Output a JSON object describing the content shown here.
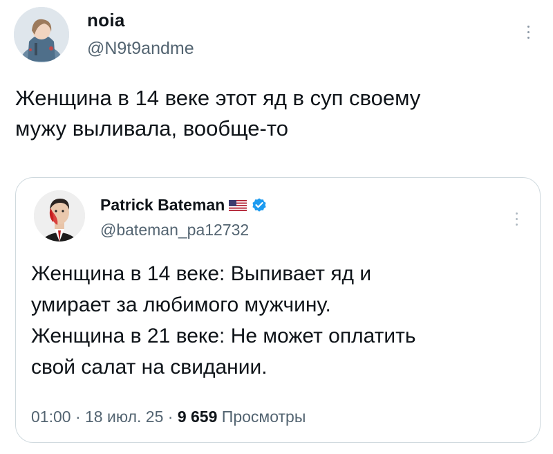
{
  "tweet": {
    "author": {
      "name": "noia",
      "handle": "@N9t9andme"
    },
    "text_lines": [
      "Женщина в 14 веке этот яд в суп своему",
      "мужу выливала, вообще-то"
    ]
  },
  "quoted_tweet": {
    "author": {
      "name": "Patrick Bateman",
      "handle": "@bateman_pa12732",
      "flag_icon": "us-flag-icon",
      "verified_icon": "verified-badge-icon",
      "verified_color": "#1d9bf0"
    },
    "text_lines": [
      "Женщина в 14 веке: Выпивает яд и",
      "умирает за любимого мужчину.",
      "Женщина в 21 веке: Не может оплатить",
      "свой салат на свидании."
    ],
    "meta": {
      "time": "01:00",
      "separator": "·",
      "date": "18 июл. 25",
      "views_count": "9 659",
      "views_label": "Просмотры"
    }
  },
  "colors": {
    "text_primary": "#0f1419",
    "text_secondary": "#536471",
    "border": "#cfd9de"
  }
}
